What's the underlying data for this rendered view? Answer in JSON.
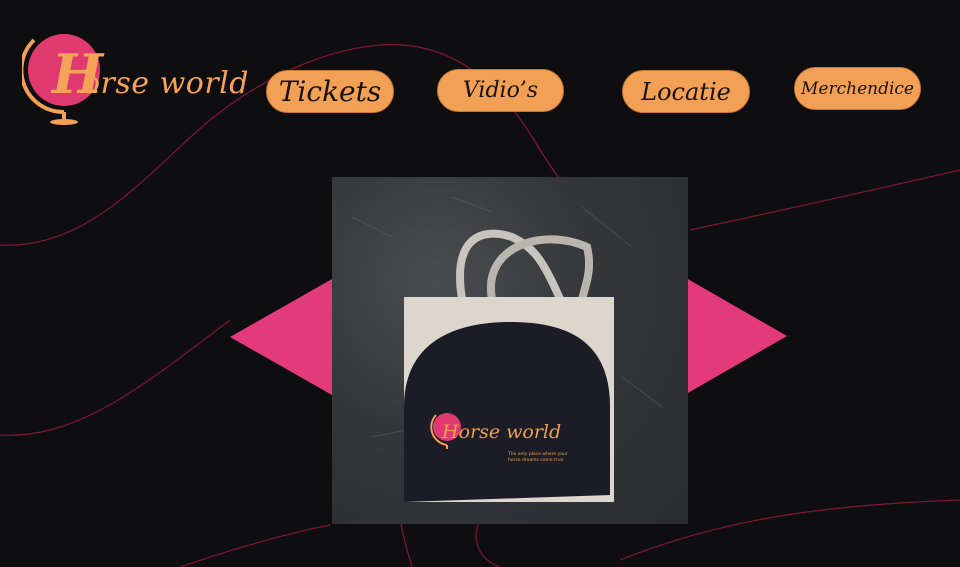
{
  "logo": {
    "initial": "H",
    "text": "orse world"
  },
  "nav": {
    "tickets": "Tickets",
    "videos": "Vidio’s",
    "locatie": "Locatie",
    "merch": "Merchendice"
  },
  "product": {
    "bag_logo_text": "Horse world",
    "tagline": "The only place where your horse dreams come true"
  },
  "colors": {
    "background": "#0e0d0f",
    "nav_button": "#f3a057",
    "arrow": "#e23a7a",
    "logo_pink": "#e0396f",
    "line_accent": "#8c1c3c"
  },
  "icons": {
    "prev": "triangle-left-icon",
    "next": "triangle-right-icon",
    "logo_globe": "globe-icon"
  }
}
